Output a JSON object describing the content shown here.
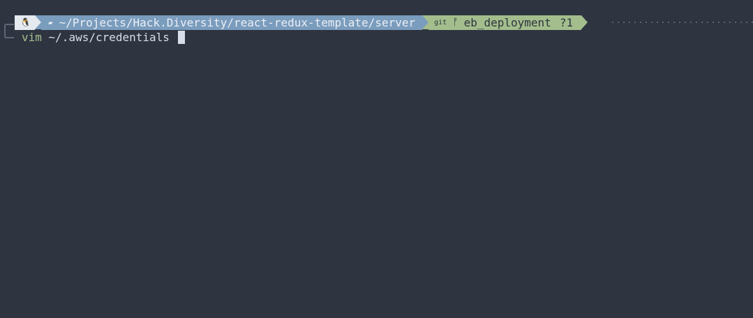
{
  "prompt": {
    "os_icon": "linux-tux-icon",
    "os_glyph": "🐧",
    "folder_icon": "folder-icon",
    "folder_glyph": "▰",
    "directory": "~/Projects/Hack.Diversity/react-redux-template/server",
    "git_icon": "git-icon",
    "git_label": "git",
    "branch_icon": "branch-icon",
    "branch_glyph": "ᚠ",
    "branch": "eb_deployment",
    "git_status": "?1"
  },
  "command": {
    "name": "vim",
    "args": " ~/.aws/credentials "
  },
  "colors": {
    "background": "#2e3440",
    "os_segment": "#e5e9f0",
    "dir_segment": "#7a9cbd",
    "git_segment": "#a3be8c",
    "command_color": "#a3be8c",
    "text": "#d8dee9"
  }
}
